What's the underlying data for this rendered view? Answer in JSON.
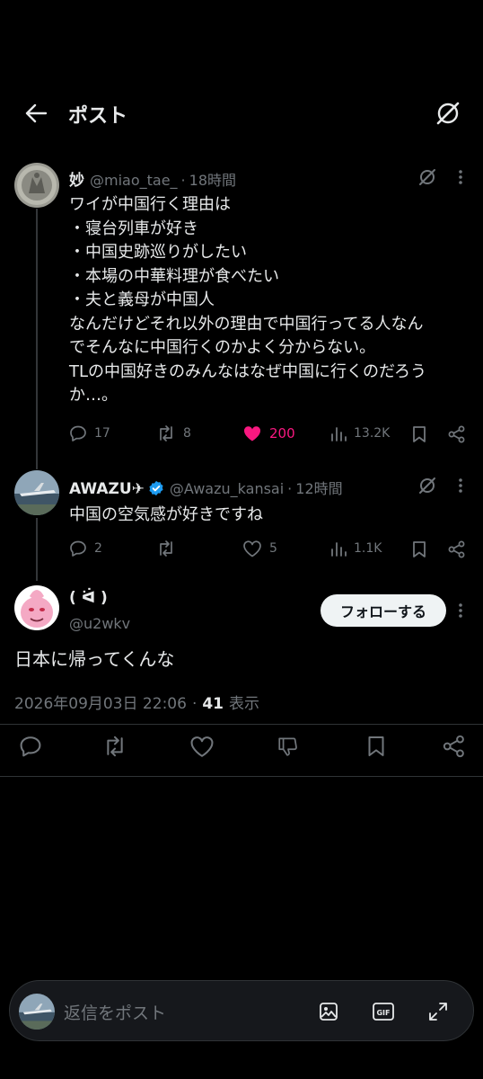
{
  "header": {
    "title": "ポスト"
  },
  "tweets": [
    {
      "name": "妙",
      "handle": "@miao_tae_",
      "time": "18時間",
      "lines": [
        "ワイが中国行く理由は",
        "・寝台列車が好き",
        "・中国史跡巡りがしたい",
        "・本場の中華料理が食べたい",
        "・夫と義母が中国人",
        "なんだけどそれ以外の理由で中国行ってる人なん",
        "でそんなに中国行くのかよく分からない。",
        "TLの中国好きのみんなはなぜ中国に行くのだろう",
        "か…。"
      ],
      "replies": "17",
      "reposts": "8",
      "likes": "200",
      "views": "13.2K"
    },
    {
      "name": "AWAZU✈",
      "handle": "@Awazu_kansai",
      "time": "12時間",
      "lines": [
        "中国の空気感が好きですね"
      ],
      "replies": "2",
      "reposts": "",
      "likes": "5",
      "views": "1.1K"
    }
  ],
  "main_post": {
    "name": "( ᐛ )",
    "handle": "@u2wkv",
    "follow_label": "フォローする",
    "text": "日本に帰ってくんな",
    "date": "2026年09月03日 22:06",
    "sep": "·",
    "view_count": "41",
    "view_label": "表示"
  },
  "reply": {
    "placeholder": "返信をポスト"
  },
  "colors": {
    "background": "#000000",
    "text": "#e7e9ea",
    "muted": "#71767b",
    "like_active": "#f91880",
    "verified": "#1d9bf0"
  },
  "icons": [
    "back-arrow-icon",
    "grok-icon",
    "more-icon",
    "reply-icon",
    "repost-icon",
    "like-icon",
    "views-icon",
    "bookmark-icon",
    "share-icon",
    "downvote-icon",
    "image-icon",
    "gif-icon",
    "expand-icon",
    "verified-badge-icon"
  ]
}
